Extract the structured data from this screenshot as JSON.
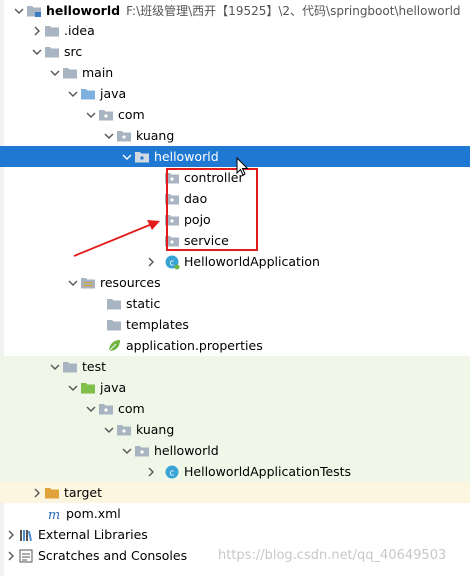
{
  "project": {
    "name": "helloworld",
    "path": "F:\\班级管理\\西开【19525】\\2、代码\\springboot\\helloworld"
  },
  "tree": {
    "idea": ".idea",
    "src": "src",
    "main": "main",
    "java": "java",
    "com": "com",
    "kuang": "kuang",
    "helloworld": "helloworld",
    "controller": "controller",
    "dao": "dao",
    "pojo": "pojo",
    "service": "service",
    "app_class": "HelloworldApplication",
    "resources": "resources",
    "static": "static",
    "templates": "templates",
    "app_props": "application.properties",
    "test": "test",
    "test_java": "java",
    "test_com": "com",
    "test_kuang": "kuang",
    "test_helloworld": "helloworld",
    "test_class": "HelloworldApplicationTests",
    "target": "target",
    "pom": "pom.xml",
    "external_libraries": "External Libraries",
    "scratches": "Scratches and Consoles"
  },
  "watermark": "https://blog.csdn.net/qq_40649503",
  "colors": {
    "selection": "#1f78d1",
    "annotation": "#e31b1b",
    "test_bg": "#f0f7e8",
    "target_bg": "#fcf5df",
    "folder": "#a9b4c2",
    "source_folder": "#8fbf5f",
    "test_folder": "#7fbf4a",
    "target_folder": "#e2a23b",
    "class_icon": "#3aa3d6"
  }
}
